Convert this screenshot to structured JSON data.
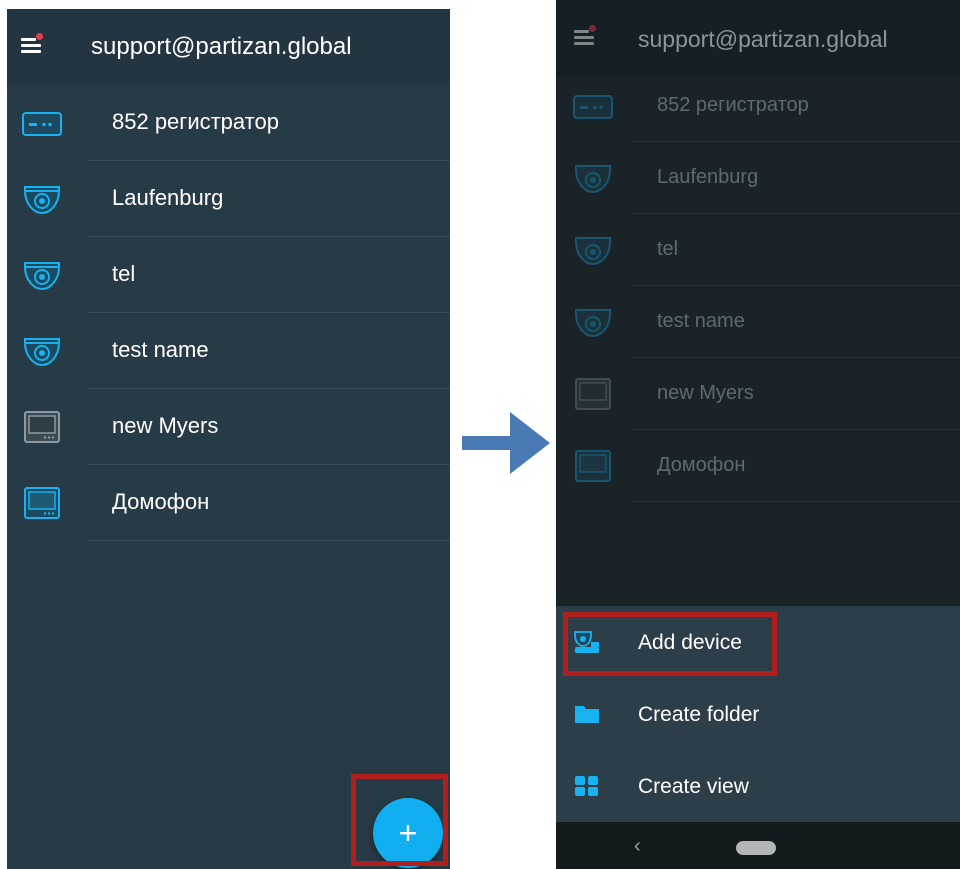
{
  "account_email": "support@partizan.global",
  "devices": [
    {
      "name": "852 регистратор",
      "icon": "dvr-icon"
    },
    {
      "name": "Laufenburg",
      "icon": "dome-camera-icon"
    },
    {
      "name": "tel",
      "icon": "dome-camera-icon"
    },
    {
      "name": "test name",
      "icon": "dome-camera-icon"
    },
    {
      "name": "new Myers",
      "icon": "intercom-monitor-icon"
    },
    {
      "name": "Домофон",
      "icon": "intercom-monitor-icon"
    }
  ],
  "fab": {
    "label": "+",
    "icon": "plus-icon"
  },
  "add_menu": [
    {
      "label": "Add device",
      "icon": "add-device-icon"
    },
    {
      "label": "Create folder",
      "icon": "folder-icon"
    },
    {
      "label": "Create view",
      "icon": "grid-view-icon"
    }
  ],
  "navbar": {
    "back": "‹"
  },
  "colors": {
    "accent": "#11aef0",
    "app_background": "#273b46",
    "highlight": "#b01e1e",
    "arrow": "#4a7ab3",
    "notification_dot": "#ef3b4d"
  }
}
